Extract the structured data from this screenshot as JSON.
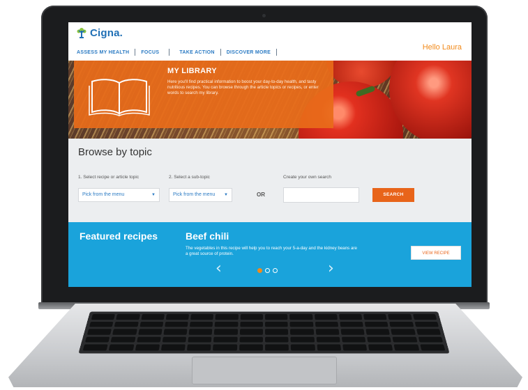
{
  "header": {
    "logo_text": "Cigna.",
    "greeting": "Hello Laura",
    "nav": [
      "ASSESS MY HEALTH",
      "FOCUS",
      "TAKE ACTION",
      "DISCOVER MORE"
    ]
  },
  "hero": {
    "title": "MY LIBRARY",
    "description": "Here you'll find practical information to boost your day-to-day health, and tasty nutritious recipes. You can browse through the article topics or recipes, or enter words to search my library."
  },
  "browse": {
    "title": "Browse by topic",
    "step1_label": "1. Select recipe or article topic",
    "step1_value": "Pick from the menu",
    "step2_label": "2. Select a sub-topic",
    "step2_value": "Pick from the menu",
    "or_label": "OR",
    "search_label": "Create your own search",
    "search_value": "",
    "search_button": "SEARCH"
  },
  "featured": {
    "label": "Featured recipes",
    "recipe_title": "Beef chili",
    "recipe_description": "The vegetables in this recipe will help you to reach your 5-a-day and the kidney beans are a great source of protein.",
    "view_button": "VIEW RECIPE",
    "carousel_total": 3,
    "carousel_active": 1
  },
  "colors": {
    "brand_blue": "#1f6fb5",
    "accent_orange": "#e8641a",
    "featured_blue": "#1aa3db"
  }
}
